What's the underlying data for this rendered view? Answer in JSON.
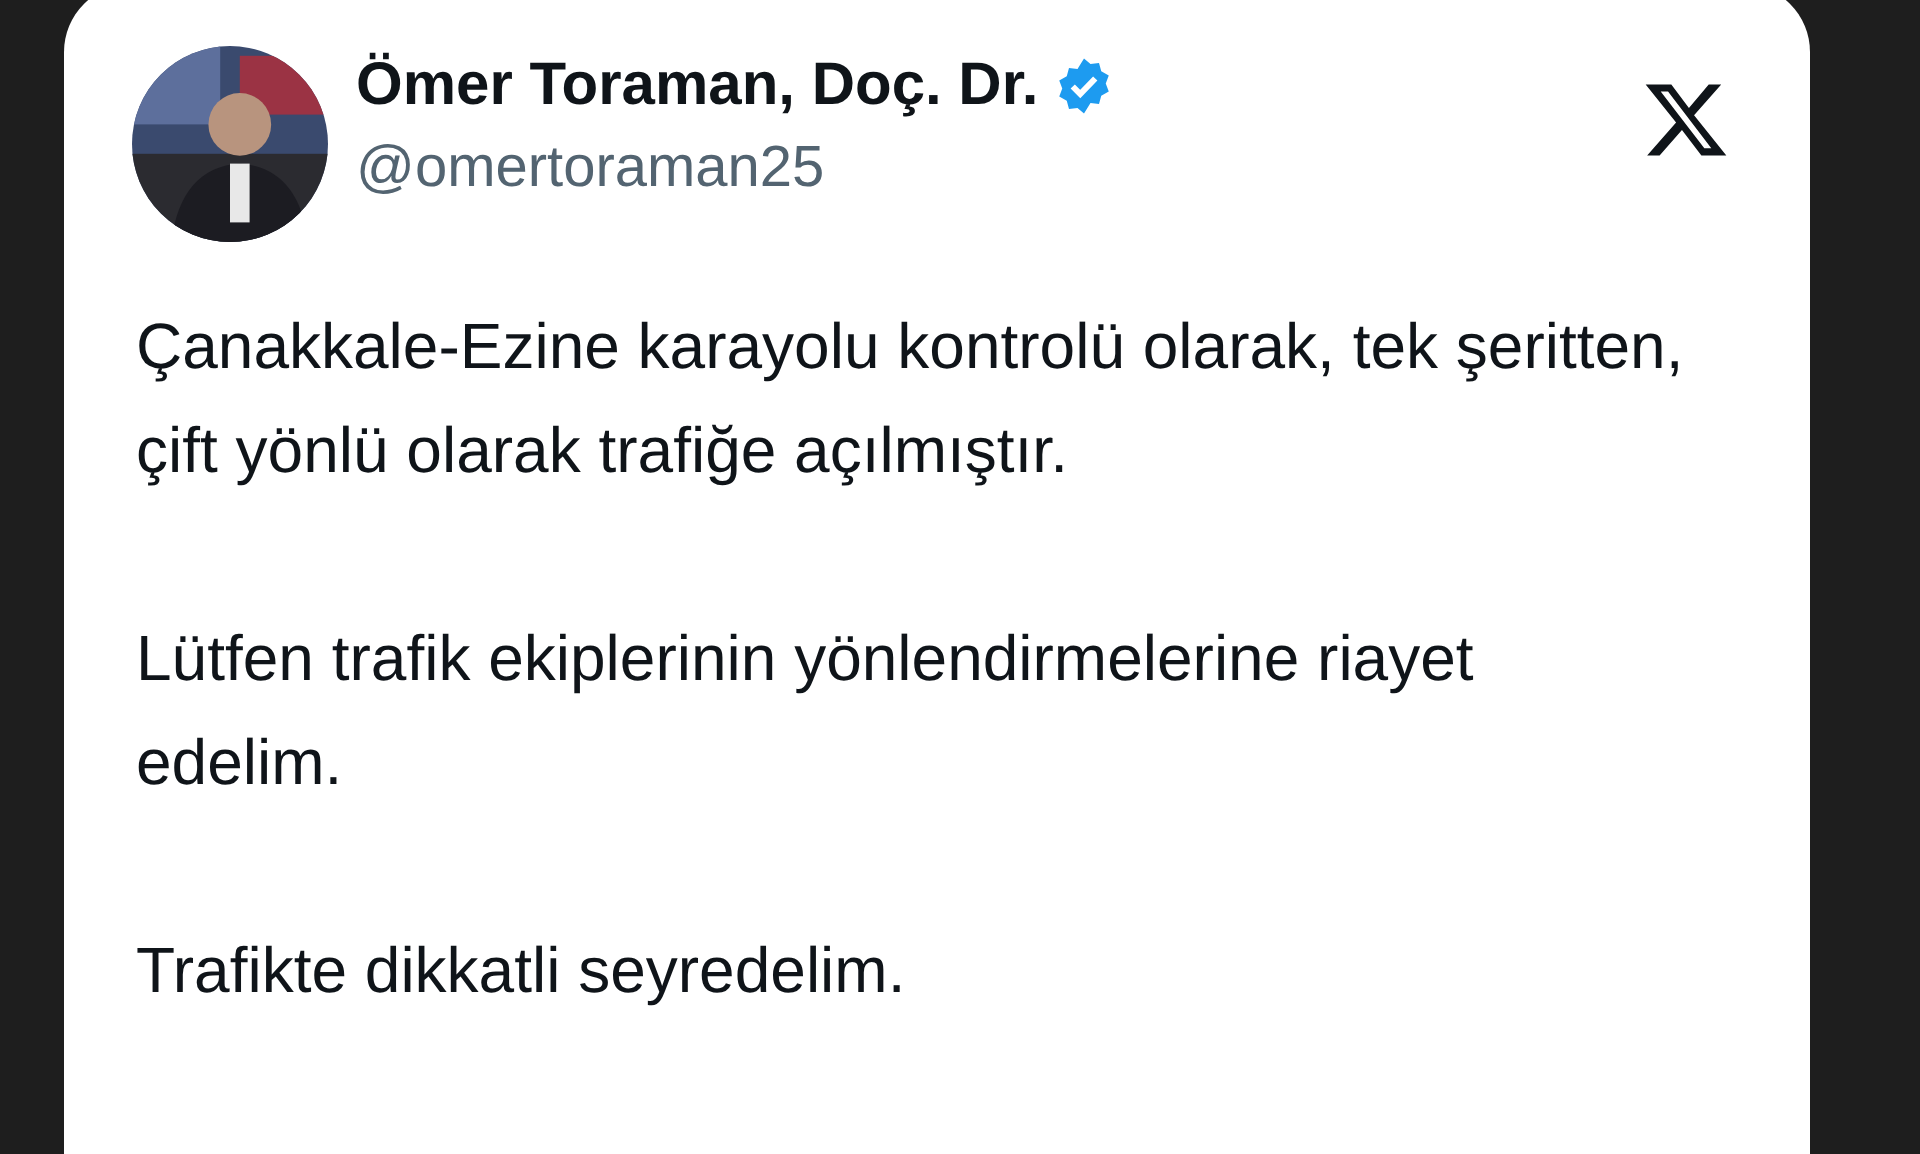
{
  "post": {
    "author": {
      "name": "Ömer Toraman, Doç. Dr.",
      "handle": "@omertoraman25",
      "verified": true
    },
    "paragraphs": [
      "Çanakkale-Ezine karayolu kontrolü olarak, tek şeritten, çift yönlü olarak trafiğe açılmıştır.",
      "Lütfen trafik ekiplerinin yönlendirmelerine riayet edelim.",
      "Trafikte dikkatli seyredelim."
    ]
  }
}
